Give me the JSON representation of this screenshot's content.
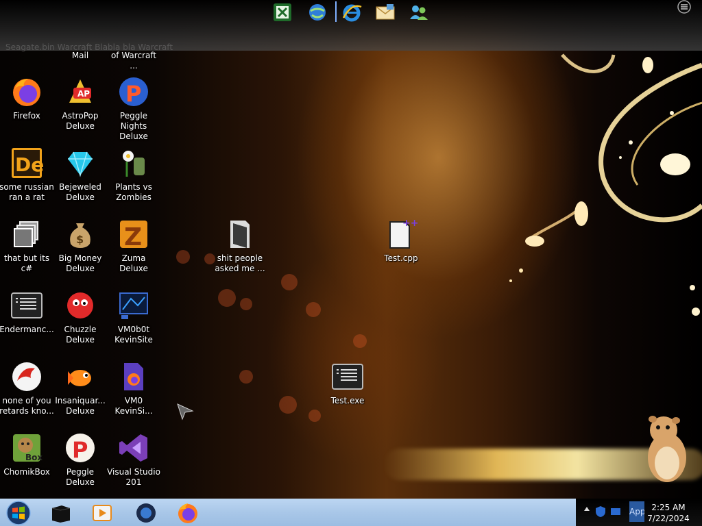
{
  "top_dock": {
    "ghost_text": "Seagate.bin   Warcraft   Blabla bla    Warcraft",
    "icons": [
      "excel-icon",
      "internet-globe-icon",
      "internet-explorer-icon",
      "mail-envelope-icon",
      "messenger-people-icon"
    ],
    "menu_icon": "menu-icon"
  },
  "desktop": {
    "top_labels": [
      "Mail",
      "of Warcraft ..."
    ],
    "icons": [
      {
        "label": "Firefox",
        "icon": "firefox-icon"
      },
      {
        "label": "AstroPop Deluxe",
        "icon": "astropop-icon"
      },
      {
        "label": "Peggle Nights Deluxe",
        "icon": "peggle-nights-icon"
      },
      {
        "label": "some russian ran a rat",
        "icon": "de-app-icon"
      },
      {
        "label": "Bejeweled Deluxe",
        "icon": "blue-gem-icon"
      },
      {
        "label": "Plants vs Zombies",
        "icon": "plants-vs-zombies-icon"
      },
      {
        "label": "that but its c#",
        "icon": "stacked-windows-icon"
      },
      {
        "label": "Big Money Deluxe",
        "icon": "money-bag-icon"
      },
      {
        "label": "Zuma Deluxe",
        "icon": "zuma-icon"
      },
      {
        "label": "Endermanc...",
        "icon": "console-app-icon"
      },
      {
        "label": "Chuzzle Deluxe",
        "icon": "chuzzle-icon"
      },
      {
        "label": "VM0b0t KevinSite",
        "icon": "vm-screen-icon"
      },
      {
        "label": "none of you retards kno...",
        "icon": "red-dragon-icon"
      },
      {
        "label": "Insaniquar... Deluxe",
        "icon": "goldfish-icon"
      },
      {
        "label": "VM0 KevinSi...",
        "icon": "firefox-document-icon"
      },
      {
        "label": "ChomikBox",
        "icon": "chomikbox-icon"
      },
      {
        "label": "Peggle Deluxe",
        "icon": "peggle-icon"
      },
      {
        "label": "Visual Studio 201",
        "icon": "visual-studio-icon"
      },
      {
        "label": "shit people asked me ...",
        "icon": "folder-icon"
      },
      {
        "label": "Test.cpp",
        "icon": "cpp-file-icon"
      },
      {
        "label": "Test.exe",
        "icon": "console-app-icon"
      }
    ]
  },
  "taskbar": {
    "start_icon": "windows-start-orb-icon",
    "pinned": [
      "black-box-icon",
      "media-player-icon",
      "dark-globe-icon",
      "firefox-icon"
    ],
    "tray_icons": [
      "show-hidden-icons-icon",
      "shield-icon",
      "network-icon",
      "app-icon"
    ],
    "tray_app_label": "App",
    "clock_time": "2:25 AM",
    "clock_date": "7/22/2024"
  },
  "colors": {
    "taskbar": "#a9c7e8",
    "tray": "#000000",
    "label_text": "#ffffff"
  }
}
